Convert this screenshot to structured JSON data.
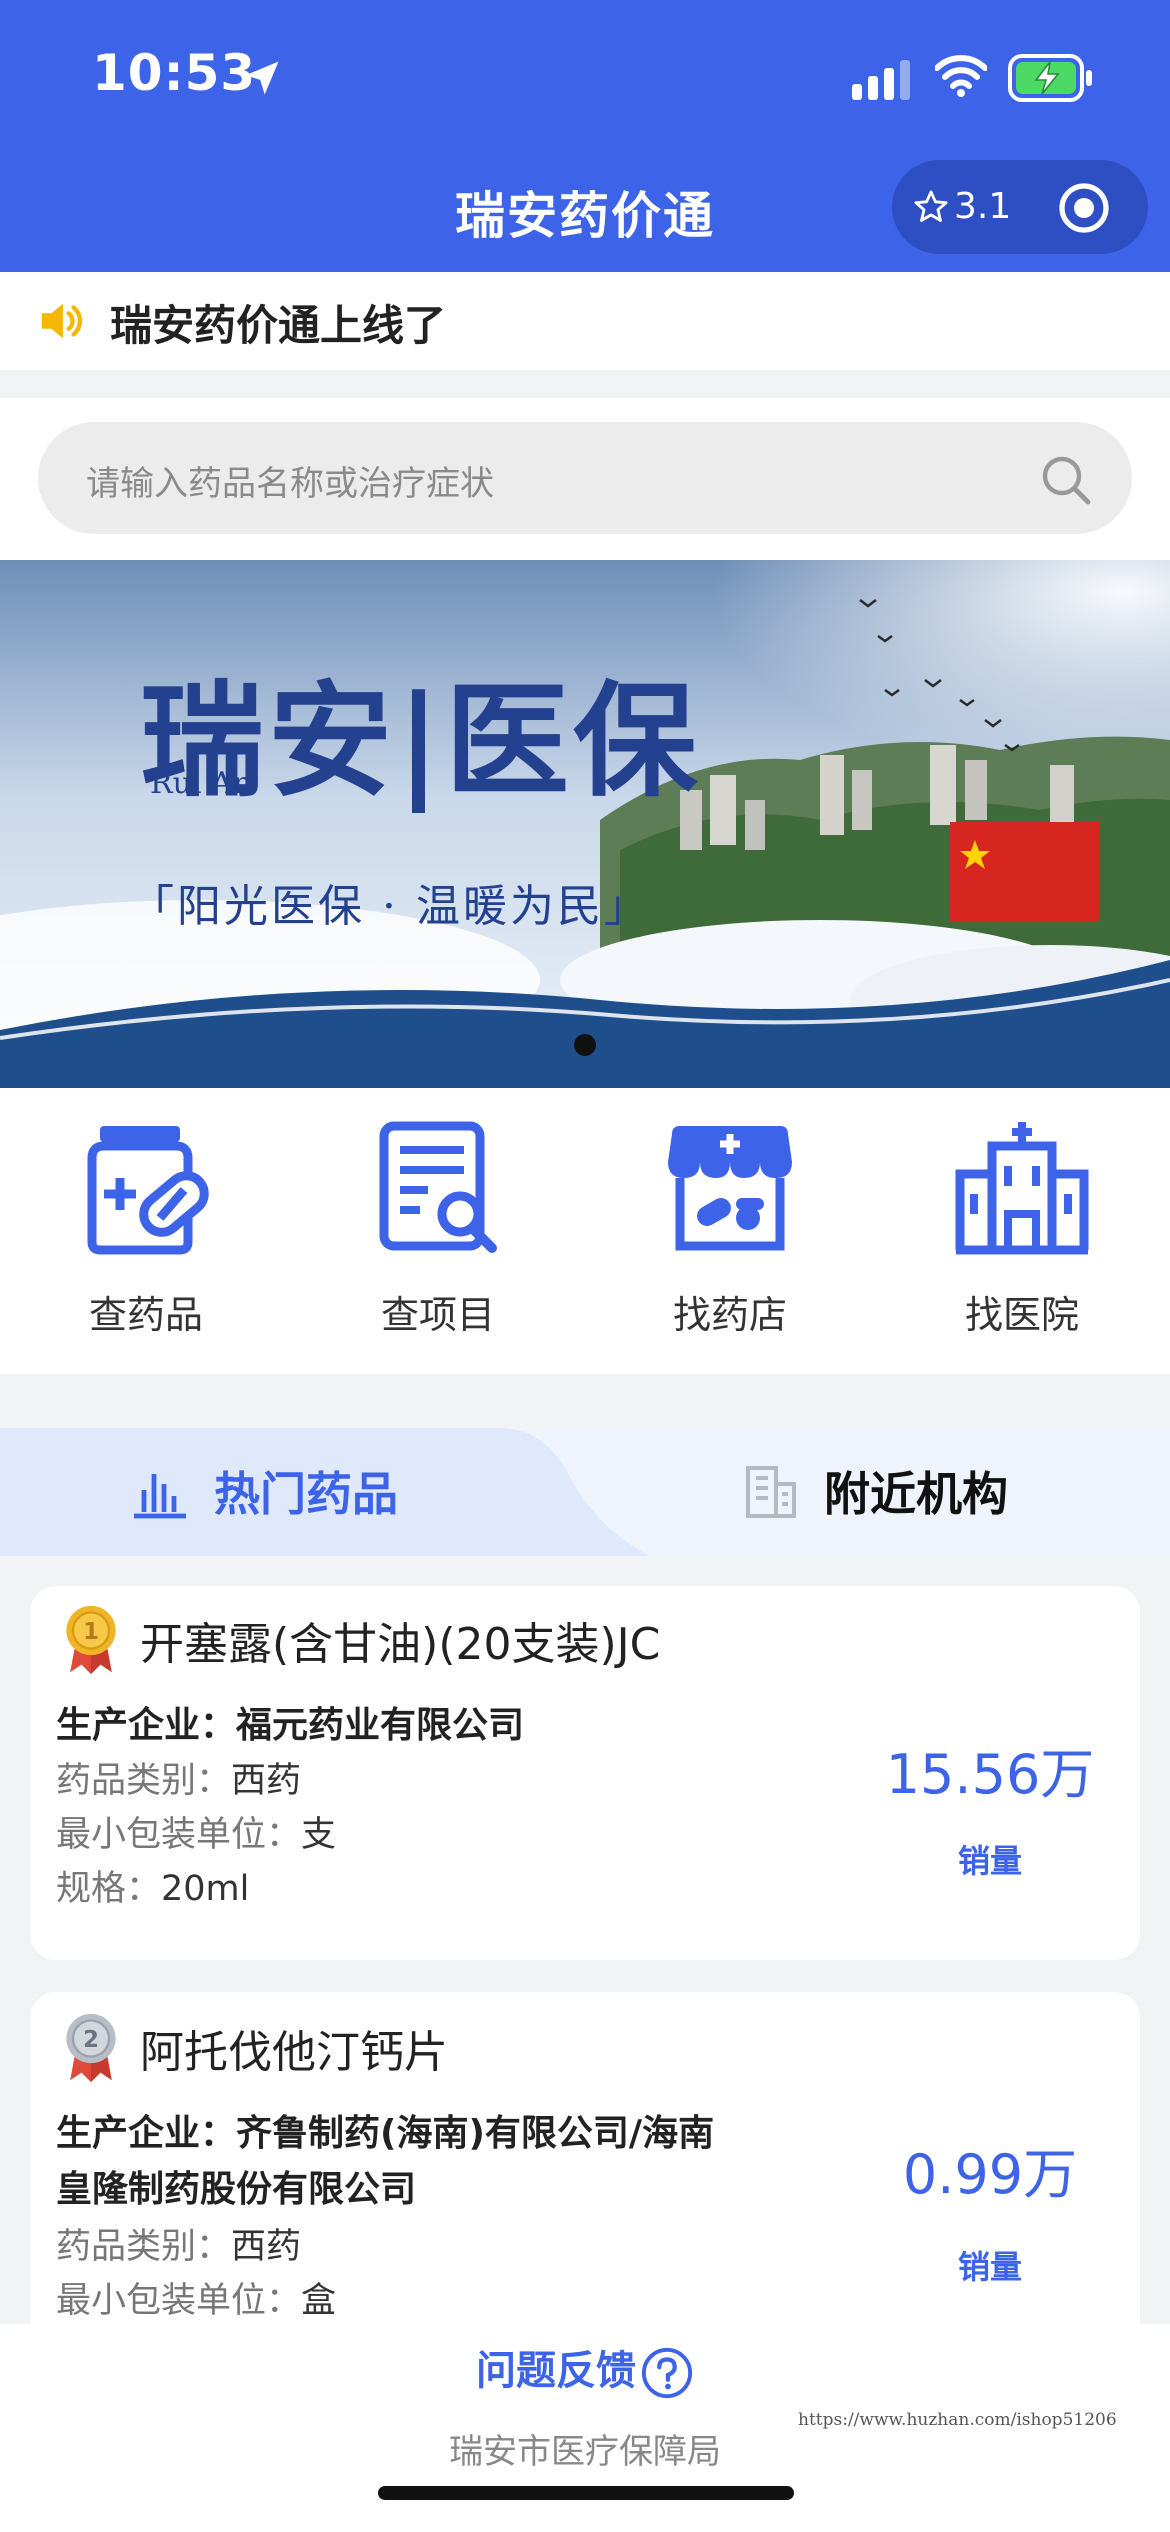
{
  "status_bar": {
    "time": "10:53"
  },
  "nav": {
    "title": "瑞安药价通",
    "capsule_score": "3.1"
  },
  "notice": {
    "text": "瑞安药价通上线了"
  },
  "search": {
    "placeholder": "请输入药品名称或治疗症状"
  },
  "banner": {
    "title": "瑞安|医保",
    "subtitle": "Rui An",
    "slogan": "「阳光医保 · 温暖为民」",
    "slides_total": 1,
    "active_slide": 1
  },
  "menu": [
    {
      "label": "查药品",
      "icon": "medicine-bottle-icon"
    },
    {
      "label": "查项目",
      "icon": "checklist-search-icon"
    },
    {
      "label": "找药店",
      "icon": "pharmacy-store-icon"
    },
    {
      "label": "找医院",
      "icon": "hospital-building-icon"
    }
  ],
  "tabs": [
    {
      "label": "热门药品",
      "icon": "bar-chart-icon",
      "active": true
    },
    {
      "label": "附近机构",
      "icon": "building-icon",
      "active": false
    }
  ],
  "drugs": [
    {
      "rank": "1",
      "name": "开塞露(含甘油)(20支装)JC",
      "company_label": "生产企业：",
      "company": "福元药业有限公司",
      "category_label": "药品类别：",
      "category": "西药",
      "unit_label": "最小包装单位：",
      "unit": "支",
      "spec_label": "规格：",
      "spec": "20ml",
      "sales": "15.56万",
      "sales_label": "销量"
    },
    {
      "rank": "2",
      "name": "阿托伐他汀钙片",
      "company_label": "生产企业：",
      "company_line1": "齐鲁制药(海南)有限公司/海南",
      "company_line2": "皇隆制药股份有限公司",
      "category_label": "药品类别：",
      "category": "西药",
      "unit_label": "最小包装单位：",
      "unit": "盒",
      "sales": "0.99万",
      "sales_label": "销量"
    }
  ],
  "footer": {
    "feedback": "问题反馈",
    "agency": "瑞安市医疗保障局",
    "watermark": "https://www.huzhan.com/ishop51206"
  },
  "colors": {
    "primary": "#3d64e8",
    "capsule": "#2e4ec4",
    "speaker": "#f5b700",
    "medal_gold": "#f0b429",
    "medal_silver": "#b8bec8",
    "ribbon": "#e04a3a"
  }
}
